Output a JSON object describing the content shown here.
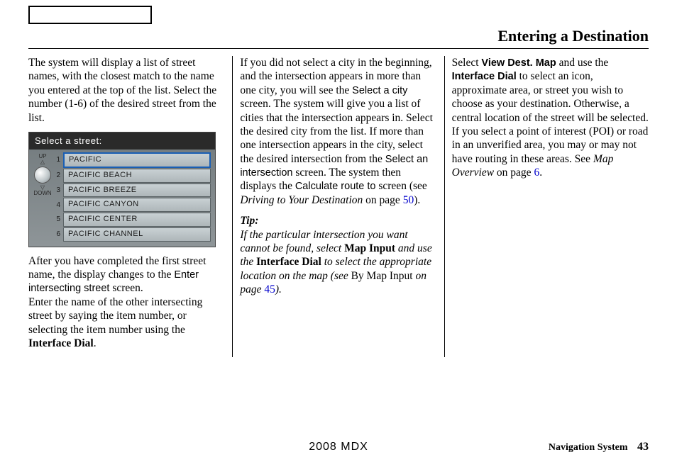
{
  "header": {
    "title": "Entering a Destination"
  },
  "col1": {
    "p1": "The system will display a list of street names, with the closest match to the name you entered at the top of the list. Select the number (1-6) of the desired street from the list.",
    "shot": {
      "head": "Select a street:",
      "up": "UP",
      "down": "DOWN",
      "items": [
        {
          "n": "1",
          "label": "PACIFIC"
        },
        {
          "n": "2",
          "label": "PACIFIC BEACH"
        },
        {
          "n": "3",
          "label": "PACIFIC BREEZE"
        },
        {
          "n": "4",
          "label": "PACIFIC CANYON"
        },
        {
          "n": "5",
          "label": "PACIFIC CENTER"
        },
        {
          "n": "6",
          "label": "PACIFIC CHANNEL"
        }
      ]
    },
    "p2a": "After you have completed the first street name, the display changes to the ",
    "p2b": "Enter intersecting street",
    "p2c": " screen.",
    "p3a": "Enter the name of the other intersecting street by saying the item number, or selecting the item number using the ",
    "p3b": "Interface Dial",
    "p3c": "."
  },
  "col2": {
    "p1a": "If you did not select a city in the beginning, and the intersection appears in more than one city, you will see the ",
    "p1b": "Select a city",
    "p1c": " screen. The system will give you a list of cities that the intersection appears in. Select the desired city from the list. If more than one intersection appears in the city, select the desired intersection from the ",
    "p1d": "Select an intersection",
    "p1e": " screen. The system then displays the ",
    "p1f": "Calculate route to",
    "p1g": " screen (see ",
    "p1h": "Driving to Your Destination",
    "p1i": " on page ",
    "p1j": "50",
    "p1k": ").",
    "tipLabel": "Tip:",
    "tip_a": "If the particular intersection you want cannot be found, select ",
    "tip_b": "Map Input",
    "tip_c": " and use the ",
    "tip_d": "Interface Dial",
    "tip_e": " to select the appropriate location on the map (see ",
    "tip_f": "By Map Input",
    "tip_g": " on page ",
    "tip_h": "45",
    "tip_i": ")."
  },
  "col3": {
    "a": "Select ",
    "b": "View Dest. Map",
    "c": " and use the ",
    "d": "Interface Dial",
    "e": " to select an icon, approximate area, or street you wish to choose as your destination. Otherwise, a central location of the street will be selected. If you select a point of interest (POI) or road in an unverified area, you may or may not have routing in these areas. See ",
    "f": "Map Overview",
    "g": " on page ",
    "h": "6",
    "i": "."
  },
  "footer": {
    "center": "2008 MDX",
    "rightLabel": "Navigation System",
    "pageNum": "43"
  }
}
